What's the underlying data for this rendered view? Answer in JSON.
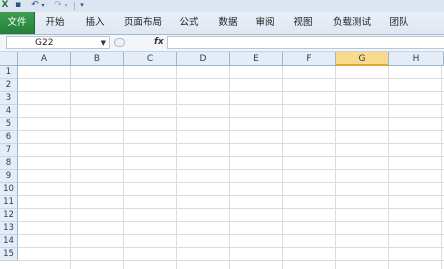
{
  "quick_access": {
    "app_icon": "excel-icon",
    "save_icon": "save-icon",
    "undo_icon": "undo-icon",
    "redo_icon": "redo-icon",
    "customize_icon": "customize-toolbar-icon"
  },
  "ribbon": {
    "tabs": [
      {
        "label": "文件"
      },
      {
        "label": "开始"
      },
      {
        "label": "插入"
      },
      {
        "label": "页面布局"
      },
      {
        "label": "公式"
      },
      {
        "label": "数据"
      },
      {
        "label": "审阅"
      },
      {
        "label": "视图"
      },
      {
        "label": "负载测试"
      },
      {
        "label": "团队"
      }
    ]
  },
  "formula_bar": {
    "name_box": "G22",
    "fx_label": "fx",
    "formula": ""
  },
  "sheet": {
    "columns": [
      "A",
      "B",
      "C",
      "D",
      "E",
      "F",
      "G",
      "H"
    ],
    "selected_column": "G",
    "rows": [
      "1",
      "2",
      "3",
      "4",
      "5",
      "6",
      "7",
      "8",
      "9",
      "10",
      "11",
      "12",
      "13",
      "14",
      "15"
    ]
  },
  "colors": {
    "file_tab": "#23803a",
    "selected_header": "#f9d98a",
    "header_bg": "#e4ecf7"
  }
}
